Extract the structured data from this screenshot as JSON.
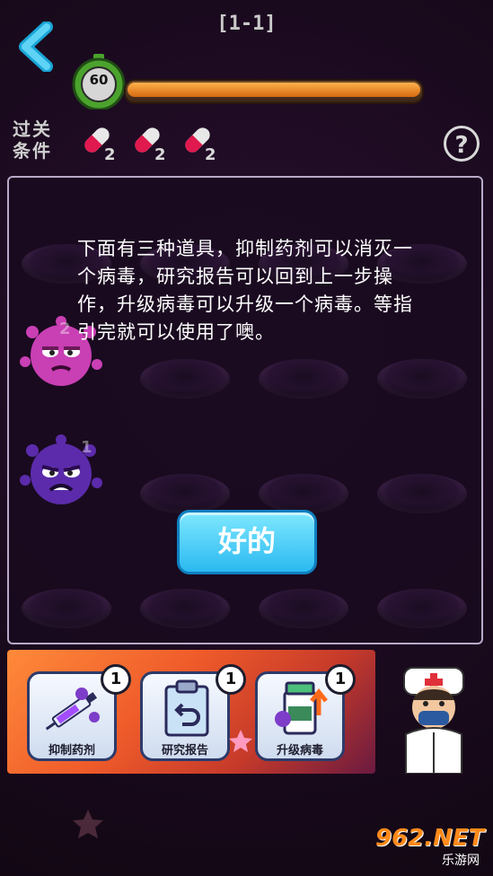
{
  "header": {
    "level": "[1-1]",
    "timer_value": "60",
    "progress_fraction": 1.0
  },
  "conditions": {
    "label": "过关\n条件",
    "pills": [
      {
        "count": "2"
      },
      {
        "count": "2"
      },
      {
        "count": "2"
      }
    ]
  },
  "dialog": {
    "text": "下面有三种道具，抑制药剂可以消灭一个病毒，研究报告可以回到上一步操作，升级病毒可以升级一个病毒。等指引完就可以使用了噢。",
    "ok_label": "好的"
  },
  "board": {
    "virus_labels": [
      "2",
      "1"
    ]
  },
  "tools": [
    {
      "label": "抑制药剂",
      "count": "1",
      "icon": "syringe-icon"
    },
    {
      "label": "研究报告",
      "count": "1",
      "icon": "clipboard-undo-icon"
    },
    {
      "label": "升级病毒",
      "count": "1",
      "icon": "upgrade-bottle-icon"
    }
  ],
  "watermark": {
    "main": "962.NET",
    "sub": "乐游网"
  },
  "colors": {
    "accent": "#2bb9f0",
    "progress": "#f39a2e",
    "board_border": "#b9a9c9"
  }
}
